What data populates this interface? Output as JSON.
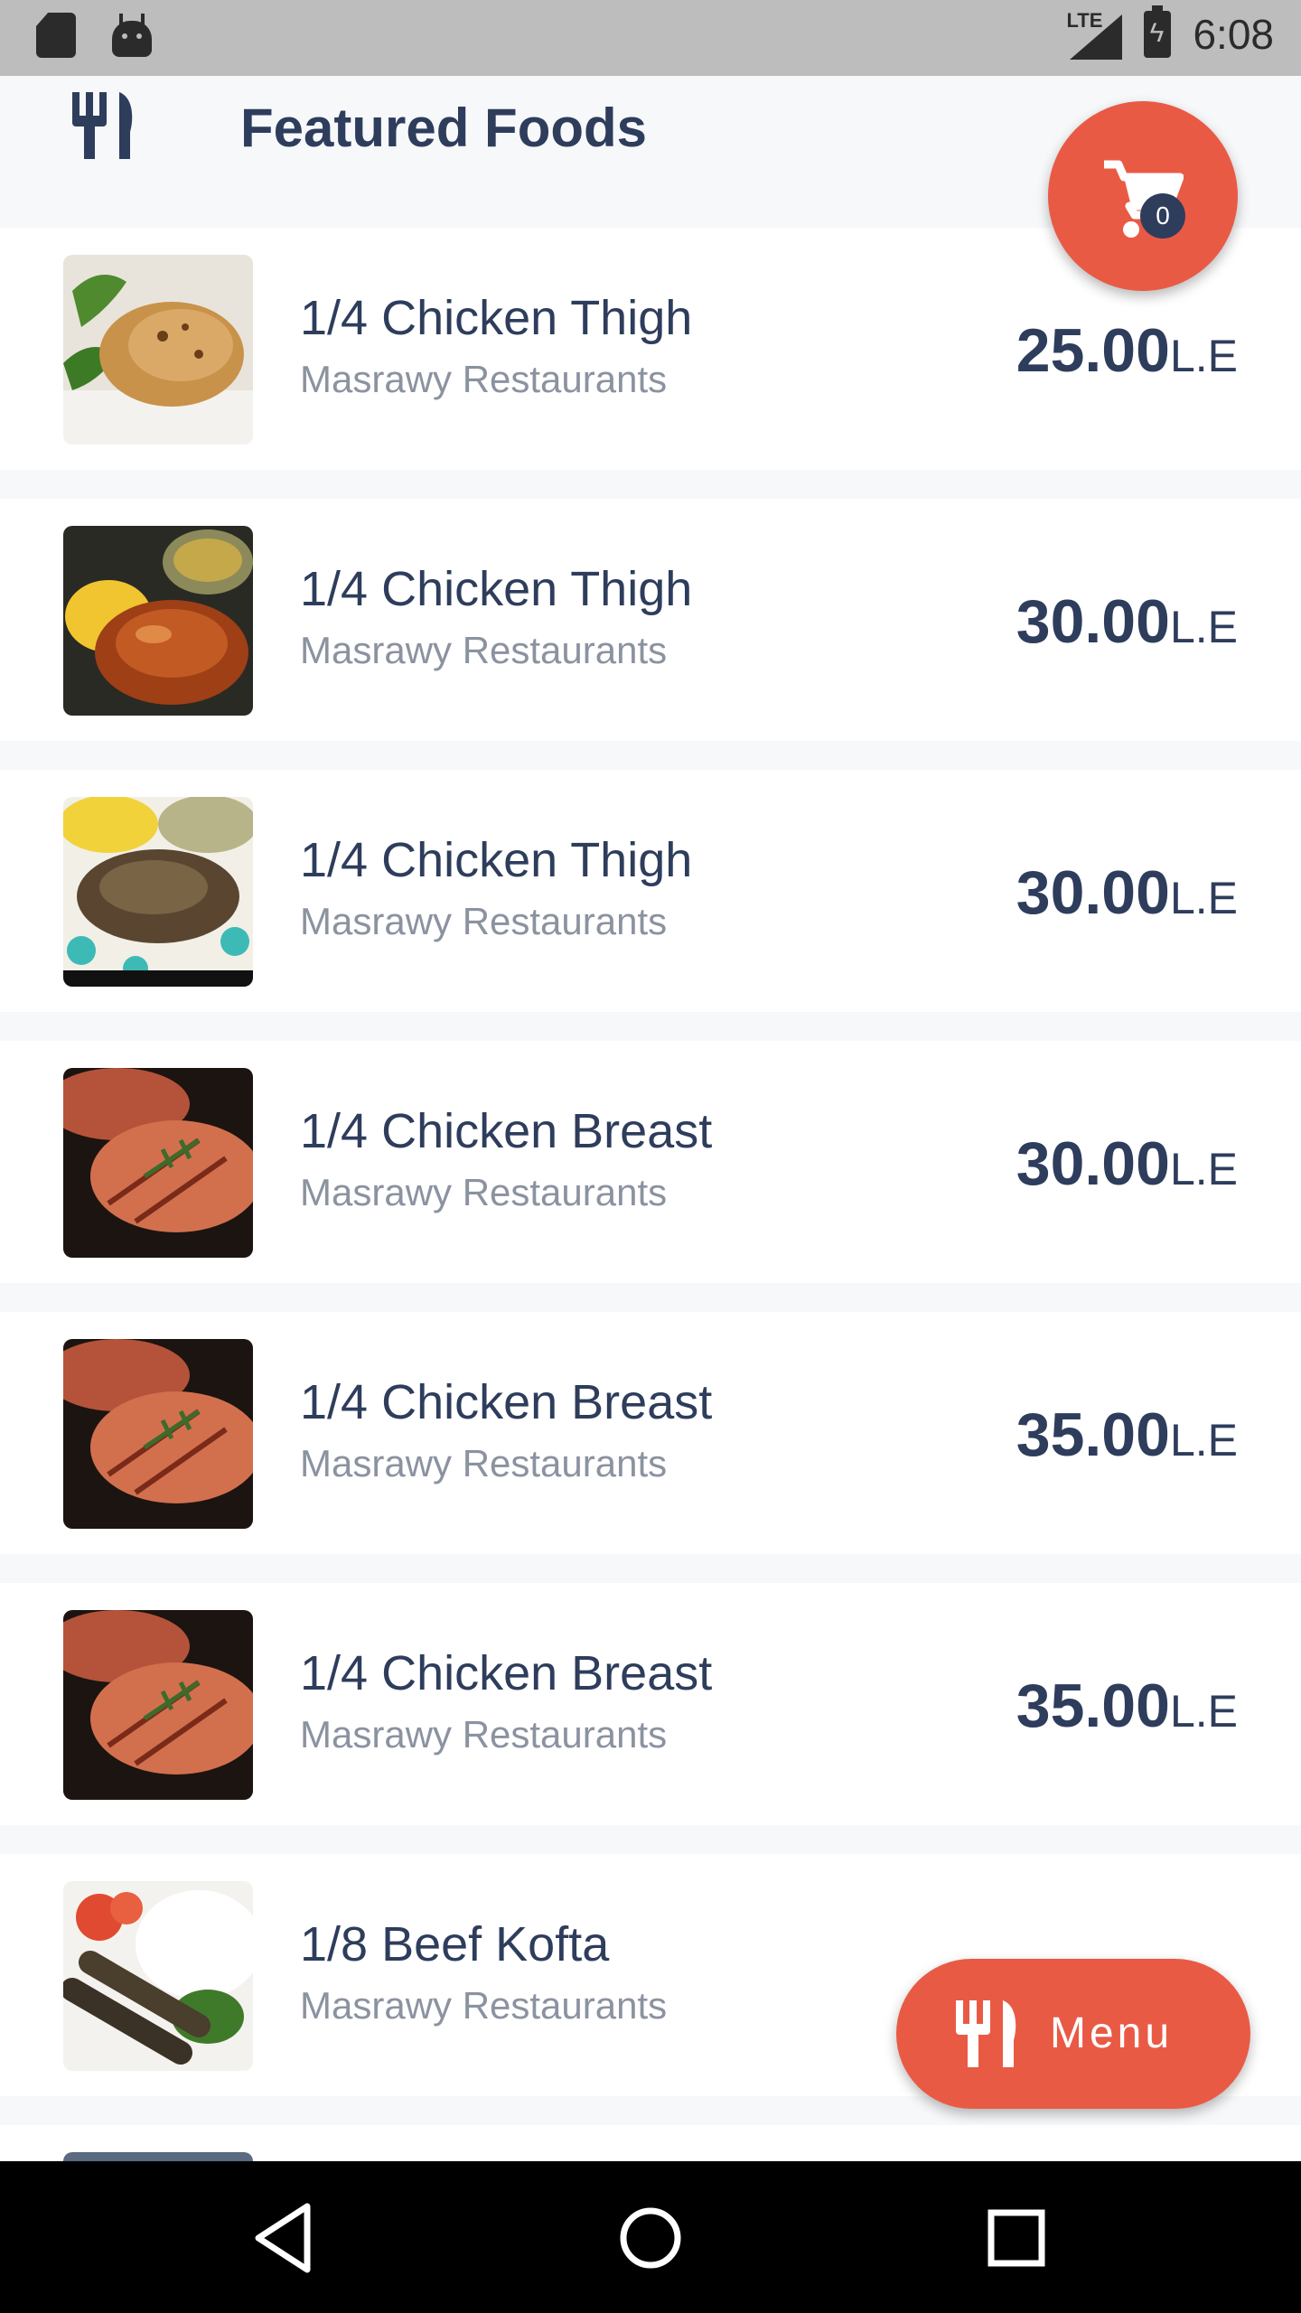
{
  "status_bar": {
    "time": "6:08",
    "network": "LTE",
    "icons": [
      "sd-card-icon",
      "android-icon",
      "signal-icon",
      "battery-charging-icon"
    ]
  },
  "header": {
    "title": "Featured Foods",
    "icon": "fork-knife-icon"
  },
  "cart": {
    "icon": "shopping-cart-icon",
    "count": "0"
  },
  "foods": [
    {
      "name": "1/4 Chicken Thigh",
      "restaurant": "Masrawy Restaurants",
      "price": "25.00",
      "currency": "L.E"
    },
    {
      "name": "1/4 Chicken Thigh",
      "restaurant": "Masrawy Restaurants",
      "price": "30.00",
      "currency": "L.E"
    },
    {
      "name": "1/4 Chicken Thigh",
      "restaurant": "Masrawy Restaurants",
      "price": "30.00",
      "currency": "L.E"
    },
    {
      "name": "1/4 Chicken Breast",
      "restaurant": "Masrawy Restaurants",
      "price": "30.00",
      "currency": "L.E"
    },
    {
      "name": "1/4 Chicken Breast",
      "restaurant": "Masrawy Restaurants",
      "price": "35.00",
      "currency": "L.E"
    },
    {
      "name": "1/4 Chicken Breast",
      "restaurant": "Masrawy Restaurants",
      "price": "35.00",
      "currency": "L.E"
    },
    {
      "name": "1/8 Beef Kofta",
      "restaurant": "Masrawy Restaurants",
      "price": "",
      "currency": ""
    }
  ],
  "menu_button": {
    "label": "Menu",
    "icon": "fork-knife-icon"
  },
  "nav_bar": {
    "icons": [
      "back-icon",
      "home-icon",
      "recents-icon"
    ]
  },
  "colors": {
    "accent": "#e95a45",
    "primary_text": "#2e3d5c",
    "secondary_text": "#8b92a0",
    "background": "#f7f8fa"
  }
}
